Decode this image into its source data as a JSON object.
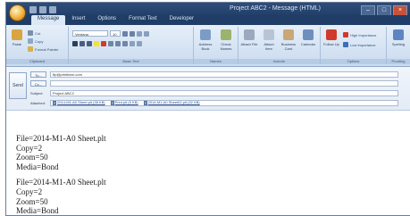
{
  "window": {
    "title": "Project ABC2 - Message (HTML)",
    "controls": [
      "–",
      "□",
      "×"
    ]
  },
  "tabs": [
    "Message",
    "Insert",
    "Options",
    "Format Text",
    "Developer"
  ],
  "ribbon": {
    "groups": [
      {
        "label": "Clipboard",
        "buttons": [
          "Paste",
          "Cut",
          "Copy",
          "Format Painter"
        ]
      },
      {
        "label": "Basic Text",
        "font": "Verdana",
        "size": "10"
      },
      {
        "label": "Names",
        "buttons": [
          "Address Book",
          "Check Names"
        ]
      },
      {
        "label": "Include",
        "buttons": [
          "Attach File",
          "Attach Item",
          "Business Card",
          "Calendar"
        ]
      },
      {
        "label": "Options",
        "buttons": [
          "Follow Up",
          "High Importance",
          "Low Importance"
        ]
      },
      {
        "label": "Proofing",
        "buttons": [
          "Spelling"
        ]
      }
    ]
  },
  "header": {
    "send_label": "Send",
    "to_label": "To...",
    "to_value": "ftp@printfarm.com",
    "cc_label": "Cc...",
    "cc_value": "",
    "subject_label": "Subject:",
    "subject_value": "Project ABC2",
    "attached_label": "Attached:",
    "attachments": [
      "2014-M1-A0 Sheet.plt (38 KB)",
      "Print.plt (5 KB)",
      "2014-M1-A0 Sheet02.plt (32 KB)"
    ]
  },
  "body": {
    "lines": [
      "File=2014-M1-A0 Sheet.plt",
      "Copy=2",
      "Zoom=50",
      "Media=Bond",
      "File=2014-M1-A0 Sheet.plt",
      "Copy=2",
      "Zoom=50",
      "Media=Bond"
    ]
  }
}
